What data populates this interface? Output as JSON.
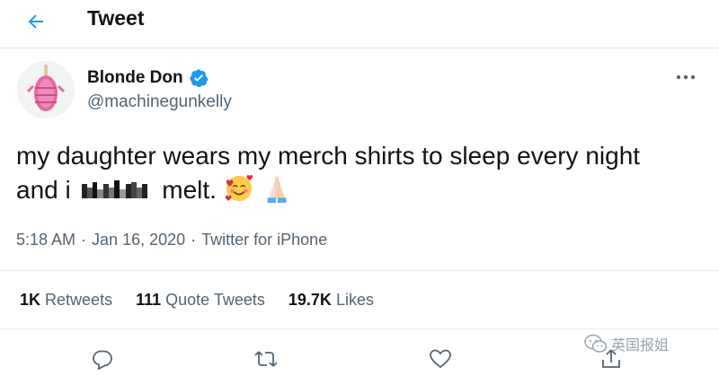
{
  "header": {
    "title": "Tweet",
    "back_icon": "arrow-left-icon"
  },
  "author": {
    "name": "Blonde Don",
    "handle": "@machinegunkelly",
    "verified": true,
    "avatar_icon": "avatar-pink-figure"
  },
  "tweet": {
    "text_part1": "my daughter wears my merch shirts to sleep every night",
    "text_part2_before": "and i",
    "text_part2_after": "melt.",
    "emojis": [
      "smiling-face-with-hearts",
      "folded-hands"
    ]
  },
  "meta": {
    "time": "5:18 AM",
    "sep1": "·",
    "date": "Jan 16, 2020",
    "sep2": "·",
    "source": "Twitter for iPhone"
  },
  "stats": {
    "retweets_count": "1K",
    "retweets_label": "Retweets",
    "quote_count": "111",
    "quote_label": "Quote Tweets",
    "likes_count": "19.7K",
    "likes_label": "Likes"
  },
  "actions": [
    "reply-icon",
    "retweet-icon",
    "like-icon",
    "share-icon"
  ],
  "watermark": {
    "text": "英国报姐"
  },
  "colors": {
    "blue": "#1d9bf0",
    "gray": "#536471",
    "border": "#e6ecf0"
  }
}
